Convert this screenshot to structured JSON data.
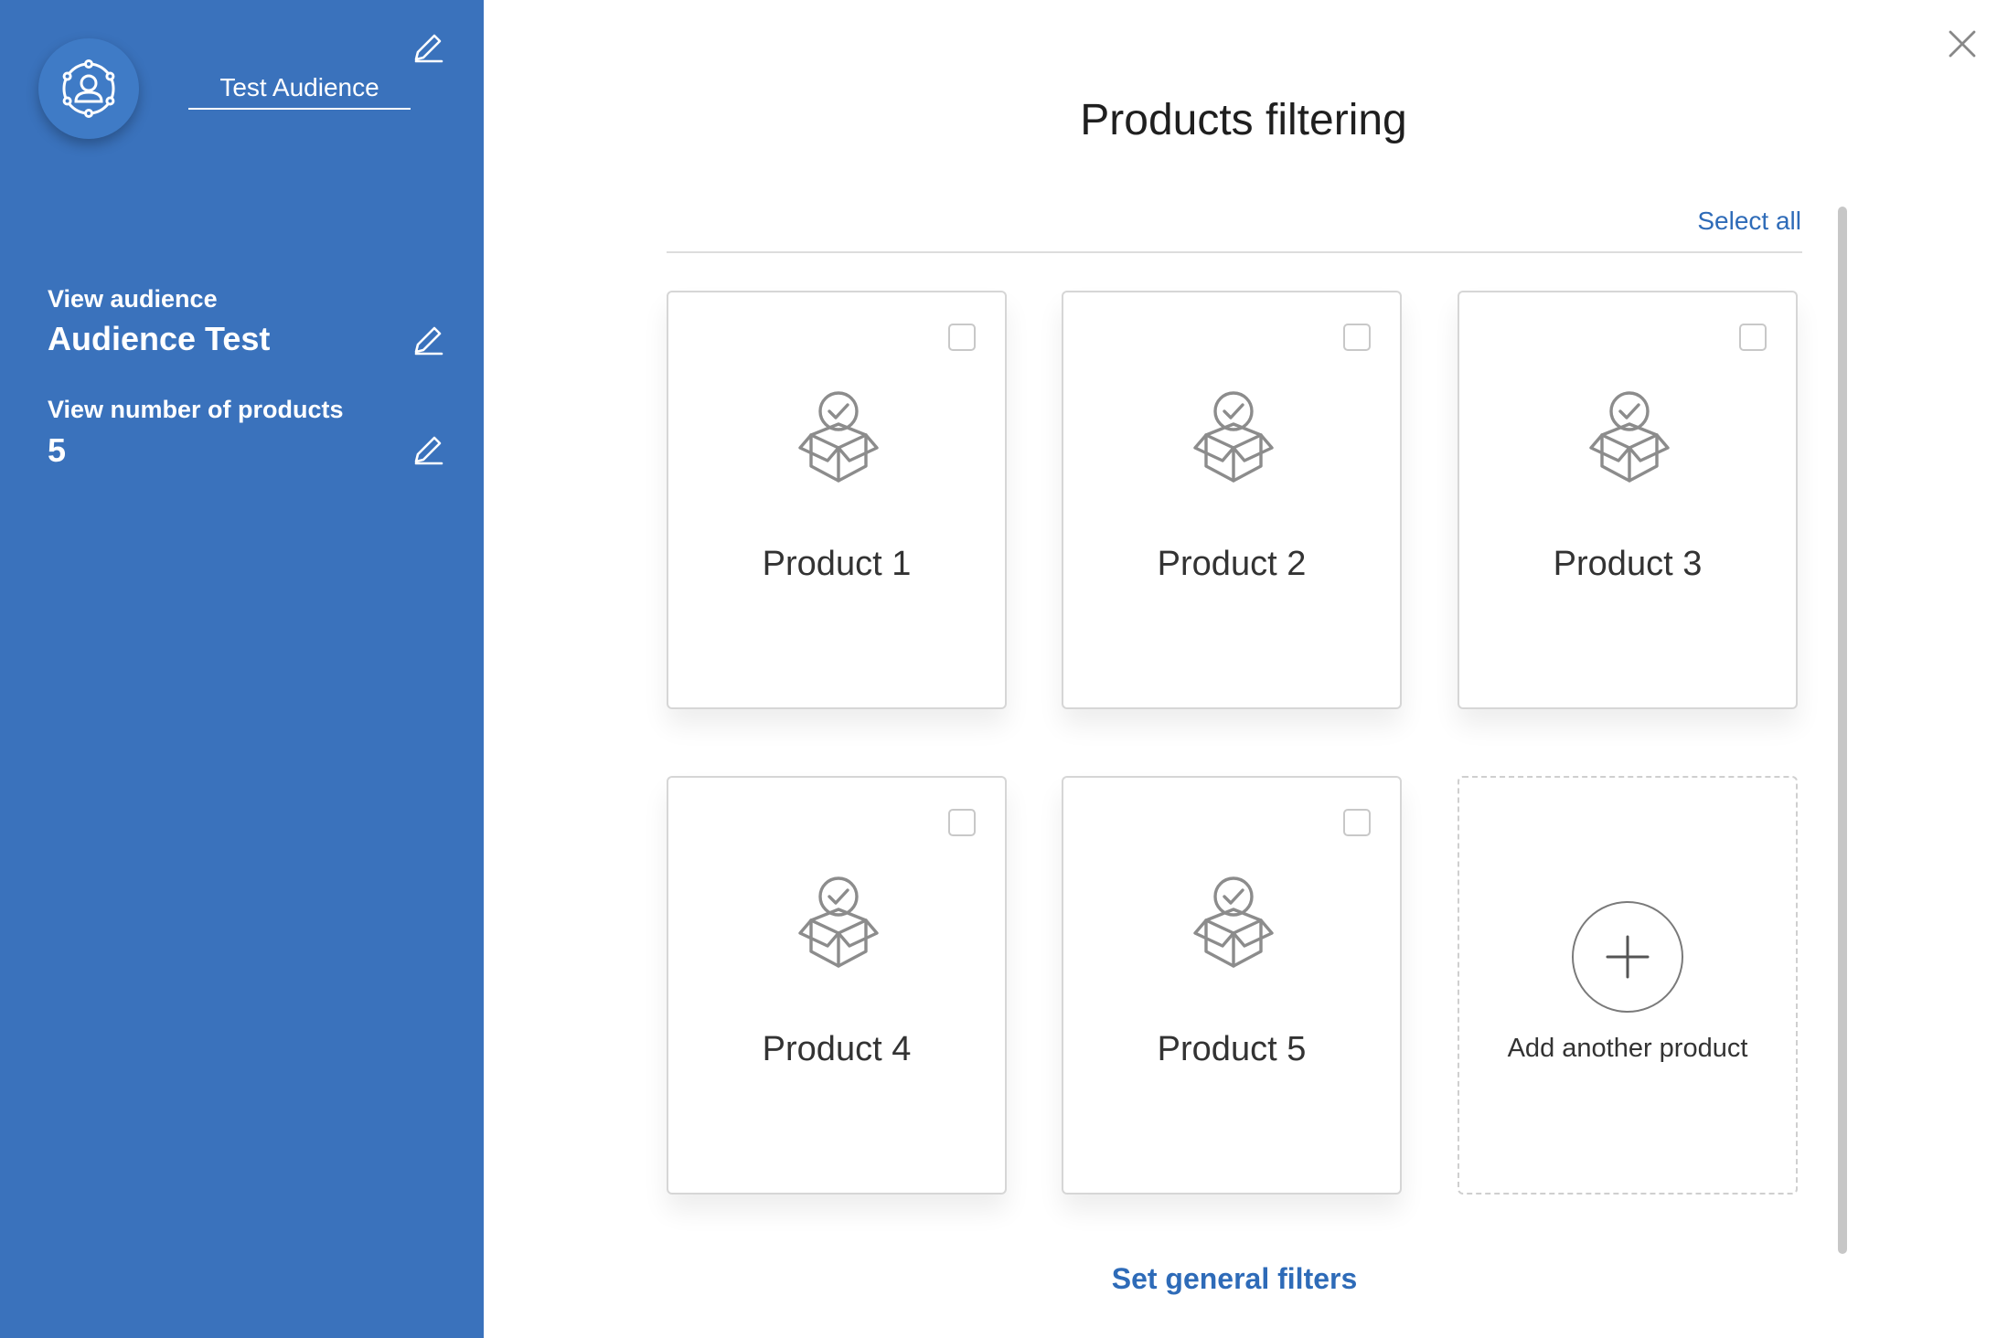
{
  "sidebar": {
    "audience_name": "Test Audience",
    "view_audience_label": "View audience",
    "view_audience_value": "Audience Test",
    "view_products_label": "View number of products",
    "view_products_value": "5",
    "avatar_icon": "audience-network-icon",
    "edit_icon": "pencil-icon",
    "background": "#3a72bc"
  },
  "main": {
    "title": "Products filtering",
    "select_all": "Select all",
    "products": [
      {
        "name": "Product 1",
        "checked": false
      },
      {
        "name": "Product 2",
        "checked": false
      },
      {
        "name": "Product 3",
        "checked": false
      },
      {
        "name": "Product 4",
        "checked": false
      },
      {
        "name": "Product 5",
        "checked": false
      }
    ],
    "add_product_label": "Add another product",
    "general_filters": "Set general filters",
    "product_icon": "box-check-icon",
    "close_icon": "close-icon",
    "accent": "#2e6bb8"
  }
}
